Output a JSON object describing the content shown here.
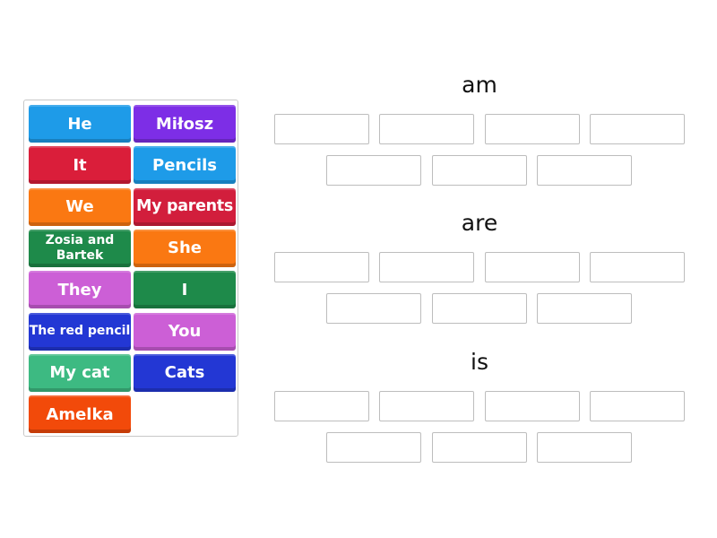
{
  "tiles": [
    {
      "label": "He",
      "color": "#1e9be8"
    },
    {
      "label": "Miłosz",
      "color": "#7d2ee6"
    },
    {
      "label": "It",
      "color": "#da1e3a"
    },
    {
      "label": "Pencils",
      "color": "#1e9be8"
    },
    {
      "label": "We",
      "color": "#fa7812"
    },
    {
      "label": "My parents",
      "color": "#d21e3c"
    },
    {
      "label": "Zosia and Bartek",
      "color": "#1e8a4a"
    },
    {
      "label": "She",
      "color": "#fa7812"
    },
    {
      "label": "They",
      "color": "#cc5fd6"
    },
    {
      "label": "I",
      "color": "#1e8a4a"
    },
    {
      "label": "The red pencil",
      "color": "#2337d4"
    },
    {
      "label": "You",
      "color": "#cc5fd6"
    },
    {
      "label": "My cat",
      "color": "#3dba82"
    },
    {
      "label": "Cats",
      "color": "#2337d4"
    },
    {
      "label": "Amelka",
      "color": "#f24a0a"
    }
  ],
  "groups": [
    {
      "heading": "am",
      "slots": 7
    },
    {
      "heading": "are",
      "slots": 7
    },
    {
      "heading": "is",
      "slots": 7
    }
  ]
}
